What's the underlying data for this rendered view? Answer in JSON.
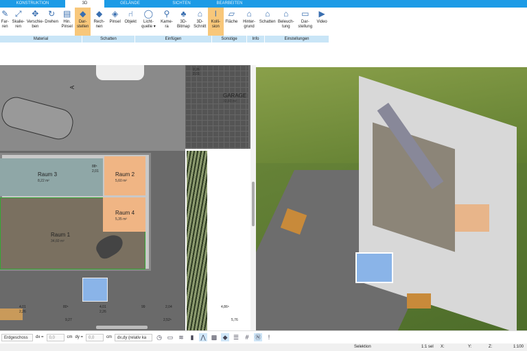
{
  "tabs": [
    "KONSTRUKTION",
    "3D",
    "GELÄNDE",
    "SICHTEN",
    "BEARBEITEN"
  ],
  "ribbon": {
    "buttons": [
      {
        "label": "Far-\nren",
        "icon": "paint-icon"
      },
      {
        "label": "Skalie-\nren",
        "icon": "scale-icon"
      },
      {
        "label": "Verschie-\nben",
        "icon": "move-icon"
      },
      {
        "label": "Drehen",
        "icon": "rotate-icon"
      },
      {
        "label": "Hin.\nPinsel",
        "icon": "brush-icon"
      },
      {
        "label": "Dar-\nstellen",
        "icon": "cube-icon",
        "active": true
      },
      {
        "label": "Rech-\nnen",
        "icon": "cube-icon"
      },
      {
        "label": "Pinsel",
        "icon": "cube-brush-icon"
      },
      {
        "label": "Objekt",
        "icon": "chair-icon"
      },
      {
        "label": "Licht-\nquelle ▾",
        "icon": "bulb-icon"
      },
      {
        "label": "Kame-\nra",
        "icon": "camera-icon"
      },
      {
        "label": "3D-\nBitmap",
        "icon": "tree-icon"
      },
      {
        "label": "3D-\nSchnitt",
        "icon": "section-icon"
      },
      {
        "label": "Kolli-\nsion",
        "icon": "collision-icon",
        "active": true
      },
      {
        "label": "Fläche",
        "icon": "area-icon"
      },
      {
        "label": "Hinter-\ngrund",
        "icon": "house-bg-icon"
      },
      {
        "label": "Schatten",
        "icon": "house-shadow-icon"
      },
      {
        "label": "Beleuch-\ntung",
        "icon": "house-light-icon"
      },
      {
        "label": "Dar-\nstellung",
        "icon": "monitor-icon"
      },
      {
        "label": "Video",
        "icon": "play-icon"
      }
    ],
    "groups": [
      "Material",
      "Schatten",
      "Einfügen",
      "Sonstige",
      "Info",
      "Einstellungen"
    ]
  },
  "plan": {
    "rooms": [
      {
        "name": "Raum 3",
        "area": "8,22 m²"
      },
      {
        "name": "Raum 2",
        "area": "5,60 m²"
      },
      {
        "name": "Raum 4",
        "area": "5,35 m²"
      },
      {
        "name": "Raum 1",
        "area": "34,60 m²"
      },
      {
        "name": "GARAGE",
        "area": "32,83 m²"
      }
    ],
    "section_marker": "A",
    "dims": [
      "4,01",
      "2,26",
      "80⁵",
      "4,01",
      "2,26",
      "99",
      "2,04",
      "4,86⁵",
      "9,27",
      "2,52⁵",
      "5,76",
      "2,26",
      "2,01",
      "88⁵",
      "2,01"
    ]
  },
  "bottombar": {
    "floor": "Erdgeschoss",
    "dx_label": "dx =",
    "dx": "0,0",
    "dy_label": "dy =",
    "dy": "0,0",
    "unit": "cm",
    "mode": "dx,dy (relativ ka"
  },
  "status": {
    "mode": "Selektion",
    "sel": "1:1 sel",
    "x": "X:",
    "y": "Y:",
    "z": "Z:",
    "scale": "1:100"
  }
}
